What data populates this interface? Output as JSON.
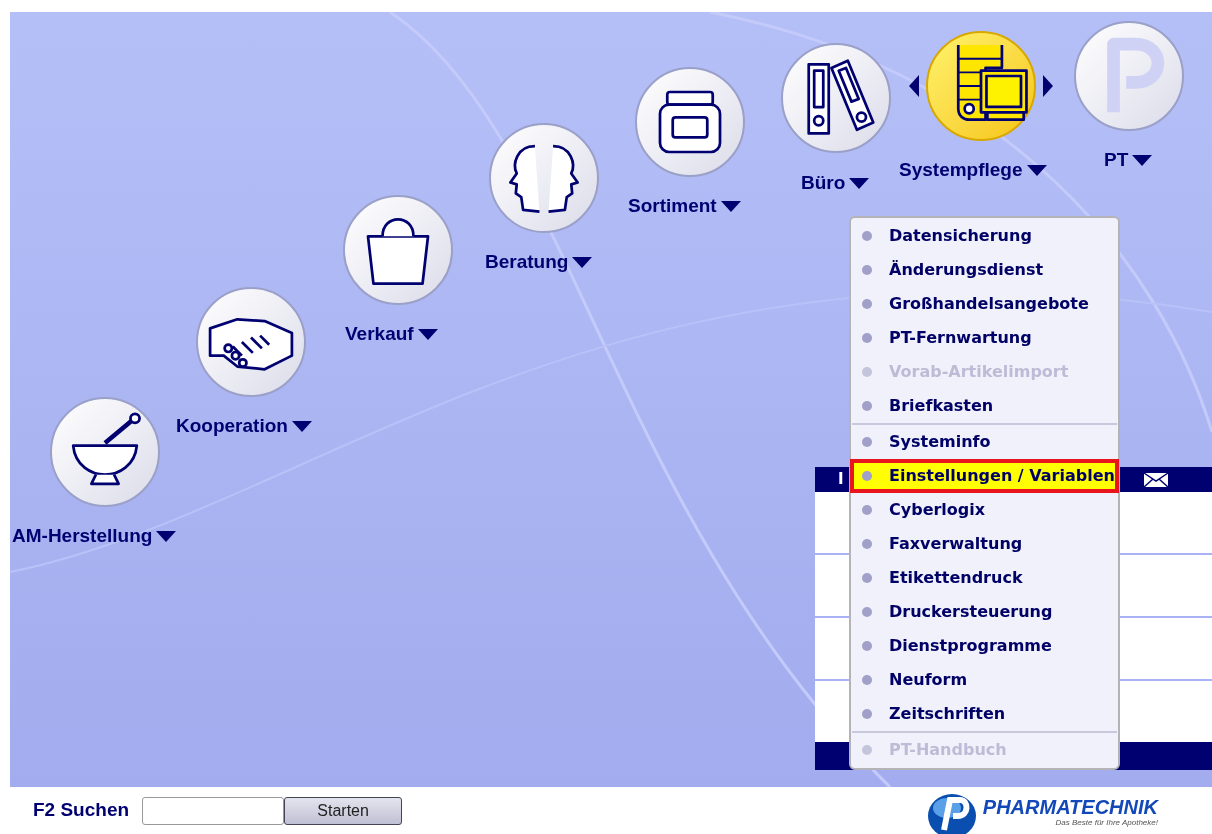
{
  "nav": {
    "items": [
      {
        "label": "AM-Herstellung",
        "kind": "mortar",
        "selected": false
      },
      {
        "label": "Kooperation",
        "kind": "handshake",
        "selected": false
      },
      {
        "label": "Verkauf",
        "kind": "bag",
        "selected": false
      },
      {
        "label": "Beratung",
        "kind": "profiles",
        "selected": false
      },
      {
        "label": "Sortiment",
        "kind": "jar",
        "selected": false
      },
      {
        "label": "Büro",
        "kind": "binders",
        "selected": false
      },
      {
        "label": "Systempflege",
        "kind": "computer",
        "selected": true
      },
      {
        "label": "PT",
        "kind": "logo",
        "selected": false
      }
    ]
  },
  "background_table": {
    "column_1": "I"
  },
  "menu": {
    "groups": [
      [
        {
          "label": "Datensicherung",
          "disabled": false,
          "selected": false
        },
        {
          "label": "Änderungsdienst",
          "disabled": false,
          "selected": false
        },
        {
          "label": "Großhandelsangebote",
          "disabled": false,
          "selected": false
        },
        {
          "label": "PT-Fernwartung",
          "disabled": false,
          "selected": false
        },
        {
          "label": "Vorab-Artikelimport",
          "disabled": true,
          "selected": false
        },
        {
          "label": "Briefkasten",
          "disabled": false,
          "selected": false
        }
      ],
      [
        {
          "label": "Systeminfo",
          "disabled": false,
          "selected": false
        },
        {
          "label": "Einstellungen / Variablen",
          "disabled": false,
          "selected": true
        },
        {
          "label": "Cyberlogix",
          "disabled": false,
          "selected": false
        },
        {
          "label": "Faxverwaltung",
          "disabled": false,
          "selected": false
        },
        {
          "label": "Etikettendruck",
          "disabled": false,
          "selected": false
        },
        {
          "label": "Druckersteuerung",
          "disabled": false,
          "selected": false
        },
        {
          "label": "Dienstprogramme",
          "disabled": false,
          "selected": false
        },
        {
          "label": "Neuform",
          "disabled": false,
          "selected": false
        },
        {
          "label": "Zeitschriften",
          "disabled": false,
          "selected": false
        }
      ],
      [
        {
          "label": "PT-Handbuch",
          "disabled": true,
          "selected": false
        }
      ]
    ]
  },
  "search": {
    "label": "F2 Suchen",
    "button": "Starten"
  },
  "brand": {
    "name": "PHARMATECHNIK",
    "tagline": "Das Beste für Ihre Apotheke!"
  }
}
